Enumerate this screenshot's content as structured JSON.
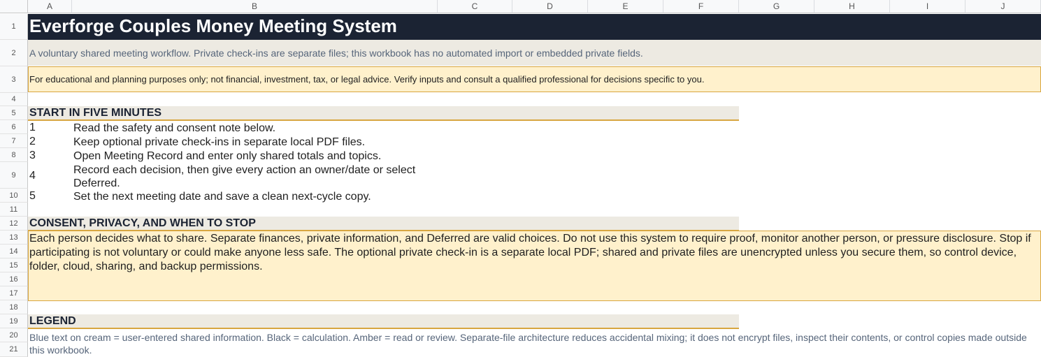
{
  "columns": [
    "A",
    "B",
    "C",
    "D",
    "E",
    "F",
    "G",
    "H",
    "I",
    "J"
  ],
  "rows": [
    "1",
    "2",
    "3",
    "4",
    "5",
    "6",
    "7",
    "8",
    "9",
    "10",
    "11",
    "12",
    "13",
    "14",
    "15",
    "16",
    "17",
    "18",
    "19",
    "20",
    "21"
  ],
  "title": "Everforge Couples Money Meeting System",
  "subtitle": "A voluntary shared meeting workflow. Private check-ins are separate files; this workbook has no automated import or embedded private fields.",
  "disclaimer": "For educational and planning purposes only; not financial, investment, tax, or legal advice. Verify inputs and consult a qualified professional for decisions specific to you.",
  "start": {
    "heading": "START IN FIVE MINUTES",
    "steps": [
      {
        "num": "1",
        "text": "Read the safety and consent note below."
      },
      {
        "num": "2",
        "text": "Keep optional private check-ins in separate local PDF files."
      },
      {
        "num": "3",
        "text": "Open Meeting Record and enter only shared totals and topics."
      },
      {
        "num": "4",
        "text": "Record each decision, then give every action an owner/date or select Deferred."
      },
      {
        "num": "5",
        "text": "Set the next meeting date and save a clean next-cycle copy."
      }
    ]
  },
  "consent": {
    "heading": "CONSENT, PRIVACY, AND WHEN TO STOP",
    "text": "Each person decides what to share. Separate finances, private information, and Deferred are valid choices. Do not use this system to require proof, monitor another person, or pressure disclosure. Stop if participating is not voluntary or could make anyone less safe. The optional private check-in is a separate local PDF; shared and private files are unencrypted unless you secure them, so control device, folder, cloud, sharing, and backup permissions."
  },
  "legend": {
    "heading": "LEGEND",
    "text": "Blue text on cream = user-entered shared information. Black = calculation. Amber = read or review. Separate-file architecture reduces accidental mixing; it does not encrypt files, inspect their contents, or control copies made outside this workbook."
  },
  "colors": {
    "title_bg": "#1b2333",
    "band_bg": "#edeae2",
    "amber_bg": "#fff1cc",
    "amber_border": "#d8a640",
    "muted_text": "#56657a"
  }
}
